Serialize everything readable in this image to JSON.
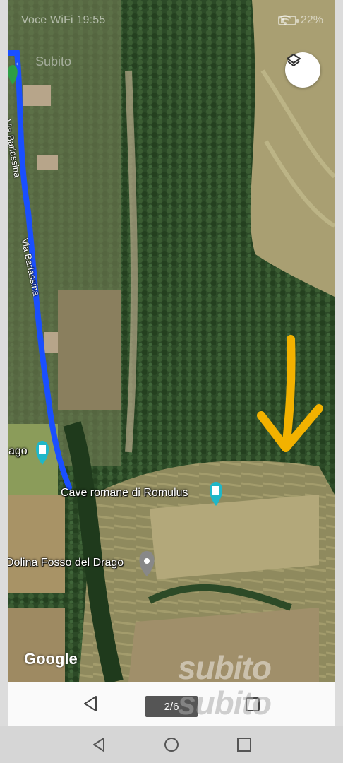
{
  "inner_status": {
    "left_text": "Voce WiFi 19:55",
    "battery": "22%"
  },
  "back": {
    "label": "Subito"
  },
  "map": {
    "roads": [
      {
        "label": "Via Barlassina"
      },
      {
        "label": "Via Barlassina"
      }
    ],
    "places": [
      {
        "label": "ago"
      },
      {
        "label": "Cave romane di Romulus"
      },
      {
        "label": "Dolina Fosso del Drago"
      }
    ],
    "attribution": "Google"
  },
  "icons": {
    "layers": "layers-icon",
    "tower_pin": "tower-icon",
    "place_pin": "place-pin-icon",
    "arrow": "down-arrow-annotation-icon"
  },
  "inner_nav": {
    "page_indicator": "2/6"
  },
  "watermark": "subito",
  "colors": {
    "route": "#1a4fff",
    "annotation": "#f2b200",
    "pin_teal": "#1fb7c8"
  }
}
